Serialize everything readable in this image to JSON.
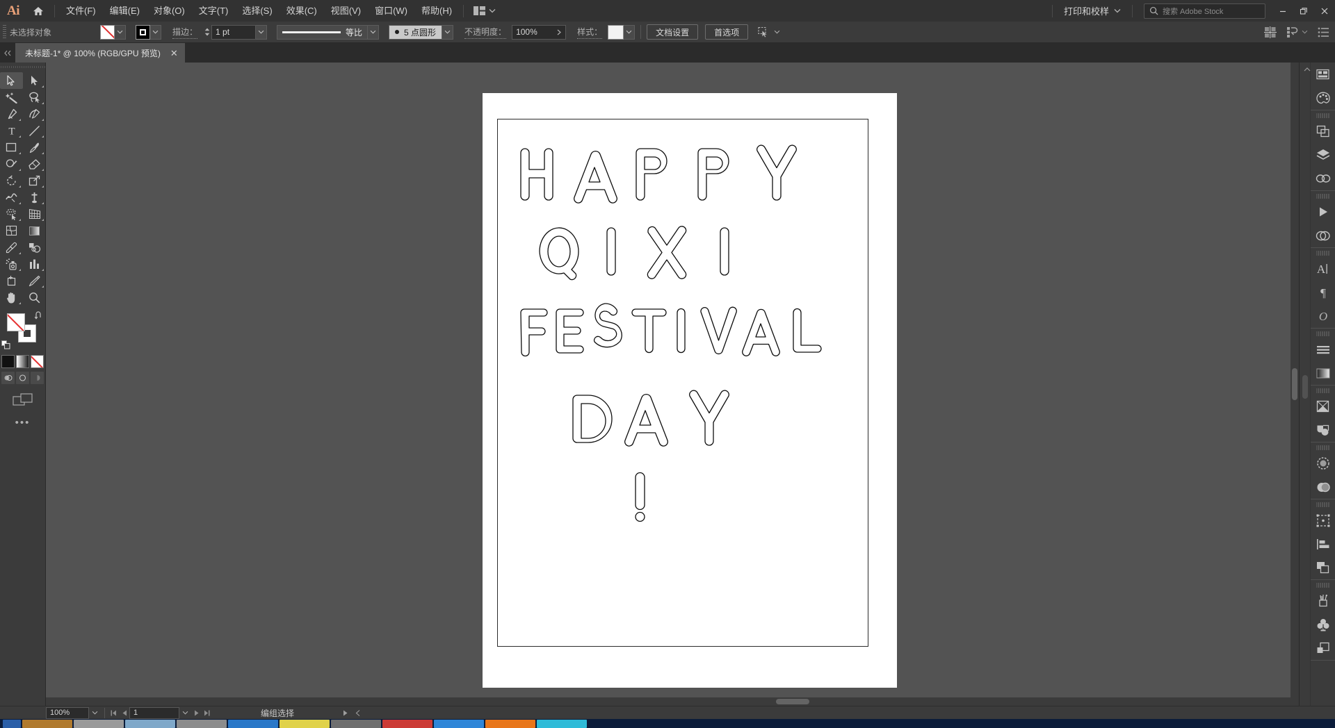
{
  "app": {
    "name": "Adobe Illustrator",
    "logo_text": "Ai",
    "accent_color": "#e9a178",
    "chrome_bg": "#323232",
    "panel_bg": "#3b3b3b",
    "canvas_bg": "#535353"
  },
  "menubar": {
    "home_icon": "home-icon",
    "items": [
      {
        "label": "文件(F)"
      },
      {
        "label": "编辑(E)"
      },
      {
        "label": "对象(O)"
      },
      {
        "label": "文字(T)"
      },
      {
        "label": "选择(S)"
      },
      {
        "label": "效果(C)"
      },
      {
        "label": "视图(V)"
      },
      {
        "label": "窗口(W)"
      },
      {
        "label": "帮助(H)"
      }
    ],
    "arrange_icon": "arrange-documents-icon",
    "arrange_caret": "chevron-down-icon",
    "workspace": {
      "label": "打印和校样",
      "caret": "chevron-down-icon"
    },
    "search": {
      "icon": "search-icon",
      "placeholder": "搜索 Adobe Stock"
    },
    "window_controls": {
      "minimize": "−",
      "restore": "❐",
      "close": "✕"
    }
  },
  "controlbar": {
    "selection_status": "未选择对象",
    "fill_swatch": {
      "name": "fill-swatch",
      "value": "none"
    },
    "stroke_swatch": {
      "name": "stroke-swatch",
      "value": "black"
    },
    "stroke_label": "描边：",
    "stroke_weight": "1 pt",
    "stroke_profile": "等比",
    "brush_definition": "5 点圆形",
    "opacity_label": "不透明度：",
    "opacity_value": "100%",
    "style_label": "样式：",
    "document_setup_button": "文档设置",
    "preferences_button": "首选项",
    "select_similar_icon": "select-similar-objects-icon",
    "right_icons": [
      {
        "name": "align-icon"
      },
      {
        "name": "transform-icon"
      },
      {
        "name": "panel-options-icon"
      }
    ]
  },
  "tabbar": {
    "collapse_icon": "collapse-icon",
    "tabs": [
      {
        "title": "未标题-1* @ 100% (RGB/GPU 预览)",
        "close": "✕",
        "active": true
      }
    ]
  },
  "toolbar": {
    "tools": [
      {
        "name": "selection-tool",
        "active": true
      },
      {
        "name": "direct-selection-tool",
        "active": false
      },
      {
        "name": "magic-wand-tool",
        "active": false
      },
      {
        "name": "lasso-tool",
        "active": false
      },
      {
        "name": "pen-tool",
        "active": false
      },
      {
        "name": "curvature-tool",
        "active": false
      },
      {
        "name": "type-tool",
        "active": false
      },
      {
        "name": "line-segment-tool",
        "active": false
      },
      {
        "name": "rectangle-tool",
        "active": false
      },
      {
        "name": "paintbrush-tool",
        "active": false
      },
      {
        "name": "shaper-tool",
        "active": false
      },
      {
        "name": "eraser-tool",
        "active": false
      },
      {
        "name": "rotate-tool",
        "active": false
      },
      {
        "name": "scale-tool",
        "active": false
      },
      {
        "name": "width-tool",
        "active": false
      },
      {
        "name": "free-transform-tool",
        "active": false
      },
      {
        "name": "shape-builder-tool",
        "active": false
      },
      {
        "name": "perspective-grid-tool",
        "active": false
      },
      {
        "name": "mesh-tool",
        "active": false
      },
      {
        "name": "gradient-tool",
        "active": false
      },
      {
        "name": "eyedropper-tool",
        "active": false
      },
      {
        "name": "blend-tool",
        "active": false
      },
      {
        "name": "symbol-sprayer-tool",
        "active": false
      },
      {
        "name": "column-graph-tool",
        "active": false
      },
      {
        "name": "artboard-tool",
        "active": false
      },
      {
        "name": "slice-tool",
        "active": false
      },
      {
        "name": "hand-tool",
        "active": false
      },
      {
        "name": "zoom-tool",
        "active": false
      }
    ],
    "fill_color": "#ffffff",
    "fill_is_none": true,
    "stroke_color": "#000000",
    "swap_icon": "swap-fill-stroke-icon",
    "default_icon": "default-fill-stroke-icon",
    "color_modes": [
      {
        "name": "color-mode-button",
        "type": "black"
      },
      {
        "name": "gradient-mode-button",
        "type": "gradient"
      },
      {
        "name": "none-mode-button",
        "type": "none"
      }
    ],
    "draw_modes": [
      {
        "name": "draw-normal-button"
      },
      {
        "name": "draw-behind-button"
      },
      {
        "name": "draw-inside-button"
      }
    ],
    "screen_mode_icon": "change-screen-mode-icon",
    "more_tools_icon": "edit-toolbar-icon"
  },
  "dock": {
    "collapse_icon": "expand-panels-icon",
    "groups": [
      {
        "icons": [
          {
            "name": "libraries-panel-icon"
          },
          {
            "name": "color-panel-icon"
          }
        ]
      },
      {
        "icons": [
          {
            "name": "pathfinder-panel-icon"
          },
          {
            "name": "layers-panel-icon"
          },
          {
            "name": "links-panel-icon"
          }
        ]
      },
      {
        "icons": [
          {
            "name": "actions-panel-icon"
          },
          {
            "name": "creative-cloud-icon"
          }
        ]
      },
      {
        "icons": [
          {
            "name": "character-panel-icon"
          },
          {
            "name": "paragraph-panel-icon"
          },
          {
            "name": "glyphs-panel-icon"
          }
        ]
      },
      {
        "icons": [
          {
            "name": "stroke-panel-icon"
          },
          {
            "name": "gradient-panel-icon"
          }
        ]
      },
      {
        "icons": [
          {
            "name": "transparency-panel-icon"
          },
          {
            "name": "appearance-panel-icon"
          }
        ]
      },
      {
        "icons": [
          {
            "name": "image-trace-panel-icon"
          },
          {
            "name": "brushes-panel-icon"
          }
        ]
      },
      {
        "icons": [
          {
            "name": "artboards-panel-icon"
          },
          {
            "name": "align-panel-icon"
          },
          {
            "name": "pathfinder-shapes-icon"
          }
        ]
      },
      {
        "icons": [
          {
            "name": "brushes-library-icon"
          },
          {
            "name": "symbols-panel-icon"
          },
          {
            "name": "asset-export-panel-icon"
          }
        ]
      }
    ]
  },
  "canvas": {
    "artwork": {
      "lines": [
        {
          "text": "HAPPY"
        },
        {
          "text": "QIXI"
        },
        {
          "text": "FESTIVAL"
        },
        {
          "text": "DAY"
        },
        {
          "text": "!"
        }
      ],
      "full_text": "HAPPY QIXI FESTIVAL DAY !",
      "style": "outlined-letters",
      "stroke_color": "#000000",
      "fill_color": "#ffffff",
      "artboard_bg": "#ffffff"
    },
    "vscroll_name": "canvas-vertical-scrollbar",
    "hscroll_name": "canvas-horizontal-scrollbar"
  },
  "statusbar": {
    "zoom_value": "100%",
    "zoom_caret": "chevron-down-icon",
    "nav_first": "first-artboard-icon",
    "nav_prev": "previous-artboard-icon",
    "artboard_number": "1",
    "artboard_caret": "chevron-down-icon",
    "nav_next": "next-artboard-icon",
    "nav_last": "last-artboard-icon",
    "status_text": "编组选择",
    "play_icon": "status-menu-icon",
    "resize_icon": "status-collapse-icon"
  },
  "taskbar": {
    "start_name": "start-button",
    "items": [
      {
        "name": "taskbar-item",
        "color": "#b07a2e"
      },
      {
        "name": "taskbar-item",
        "color": "#9a9a9a"
      },
      {
        "name": "taskbar-item",
        "color": "#7fa8c9"
      },
      {
        "name": "taskbar-item",
        "color": "#8c8c8c"
      },
      {
        "name": "taskbar-item",
        "color": "#2a78c8"
      },
      {
        "name": "taskbar-item",
        "color": "#e0d24a"
      },
      {
        "name": "taskbar-item",
        "color": "#6f6f6f"
      },
      {
        "name": "taskbar-item",
        "color": "#cc3b36"
      },
      {
        "name": "taskbar-item",
        "color": "#2f86d8"
      },
      {
        "name": "taskbar-item",
        "color": "#e8761a"
      },
      {
        "name": "taskbar-item",
        "color": "#2fbbd8"
      }
    ]
  }
}
